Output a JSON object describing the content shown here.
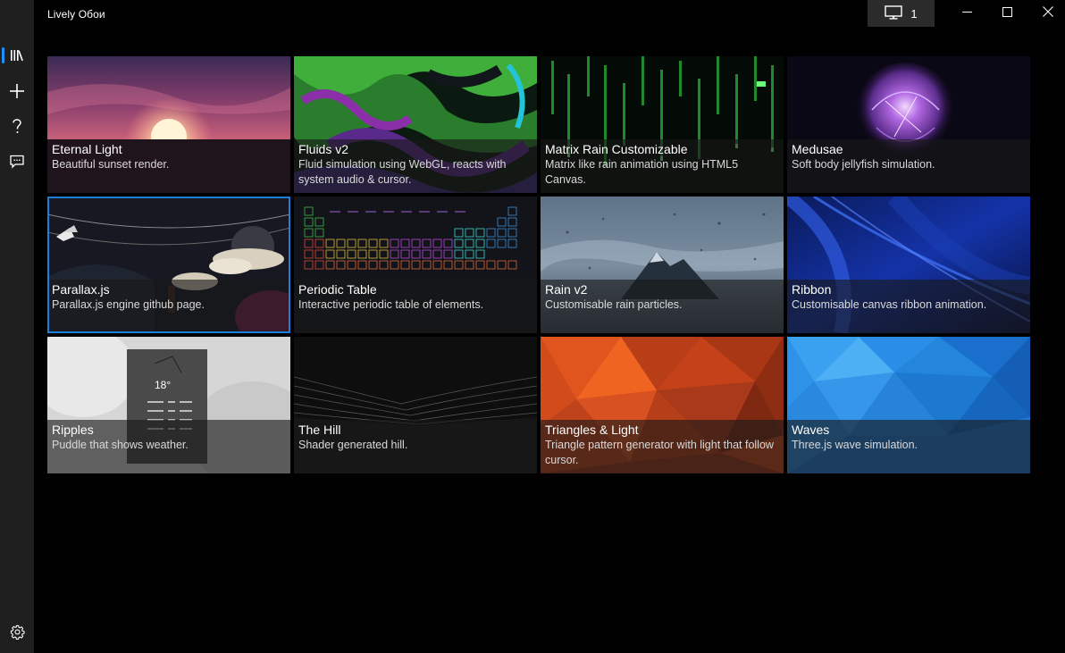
{
  "app": {
    "title": "Lively Обои"
  },
  "titlebar": {
    "monitor_count": "1",
    "monitor_icon": "monitor-icon",
    "minimize_icon": "minimize-icon",
    "maximize_icon": "maximize-icon",
    "close_icon": "close-icon"
  },
  "nav": {
    "items": [
      {
        "name": "library",
        "icon": "library-icon"
      },
      {
        "name": "add-wallpaper",
        "icon": "plus-icon"
      },
      {
        "name": "help",
        "icon": "question-icon"
      },
      {
        "name": "feedback",
        "icon": "feedback-icon"
      },
      {
        "name": "settings",
        "icon": "gear-icon"
      }
    ],
    "accent": "#1e90ff"
  },
  "wallpapers": [
    {
      "title": "Eternal Light",
      "desc": "Beautiful sunset render."
    },
    {
      "title": "Fluids v2",
      "desc": "Fluid simulation using WebGL, reacts with system audio & cursor."
    },
    {
      "title": "Matrix Rain Customizable",
      "desc": "Matrix like rain animation using HTML5 Canvas."
    },
    {
      "title": "Medusae",
      "desc": "Soft body jellyfish simulation."
    },
    {
      "title": "Parallax.js",
      "desc": "Parallax.js engine github page.",
      "selected": true
    },
    {
      "title": "Periodic Table",
      "desc": "Interactive periodic table of elements."
    },
    {
      "title": "Rain v2",
      "desc": "Customisable rain particles."
    },
    {
      "title": "Ribbon",
      "desc": "Customisable canvas ribbon animation."
    },
    {
      "title": "Ripples",
      "desc": "Puddle that shows weather."
    },
    {
      "title": "The Hill",
      "desc": "Shader generated hill."
    },
    {
      "title": "Triangles & Light",
      "desc": "Triangle pattern generator with light that follow cursor."
    },
    {
      "title": "Waves",
      "desc": "Three.js wave simulation."
    }
  ],
  "ripples_widget": {
    "temp": "18°"
  },
  "colors": {
    "background": "#000000",
    "nav_background": "#1f1f1f",
    "selection_border": "#1e7fd6"
  }
}
